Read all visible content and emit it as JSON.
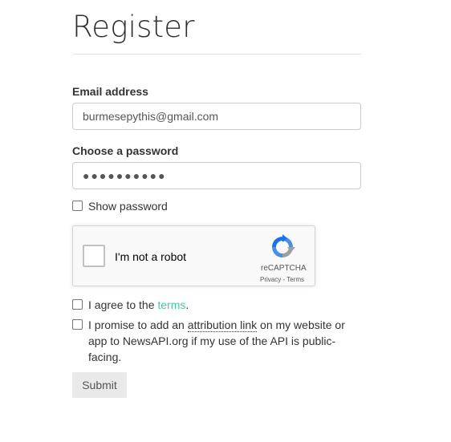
{
  "page": {
    "title": "Register"
  },
  "email": {
    "label": "Email address",
    "value": "burmesepythis@gmail.com"
  },
  "password": {
    "label": "Choose a password",
    "value": "●●●●●●●●●●"
  },
  "show_password": {
    "label": "Show password",
    "checked": false
  },
  "captcha": {
    "label": "I'm not a robot",
    "brand": "reCAPTCHA",
    "privacy": "Privacy",
    "separator": " - ",
    "terms": "Terms",
    "icon": "recaptcha-icon"
  },
  "agree_terms": {
    "prefix": "I agree to the ",
    "link": "terms",
    "suffix": ".",
    "checked": false
  },
  "attribution": {
    "prefix": "I promise to add an ",
    "link": "attribution link",
    "suffix": " on my website or app to NewsAPI.org if my use of the API is public-facing.",
    "checked": false
  },
  "submit": {
    "label": "Submit"
  },
  "colors": {
    "link": "#4fbfa8",
    "button_bg": "#e9e9e9"
  }
}
